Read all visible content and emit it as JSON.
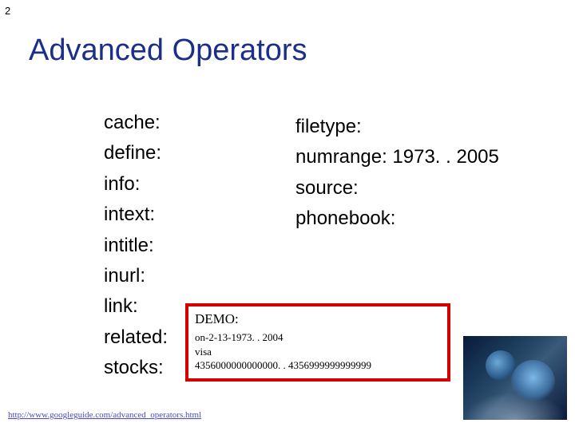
{
  "page_number": "2",
  "title": "Advanced Operators",
  "left_operators": [
    "cache:",
    "define:",
    "info:",
    "intext:",
    "intitle:",
    "inurl:",
    "link:",
    "related:",
    "stocks:"
  ],
  "right_operators": [
    "filetype:",
    "numrange: 1973. . 2005",
    "source:",
    "phonebook:"
  ],
  "demo": {
    "label": "DEMO:",
    "line1": "on-2-13-1973. . 2004",
    "line2a": "visa",
    "line2b": "4356000000000000. . 4356999999999999"
  },
  "footer_url": "http://www.googleguide.com/advanced_operators.html"
}
